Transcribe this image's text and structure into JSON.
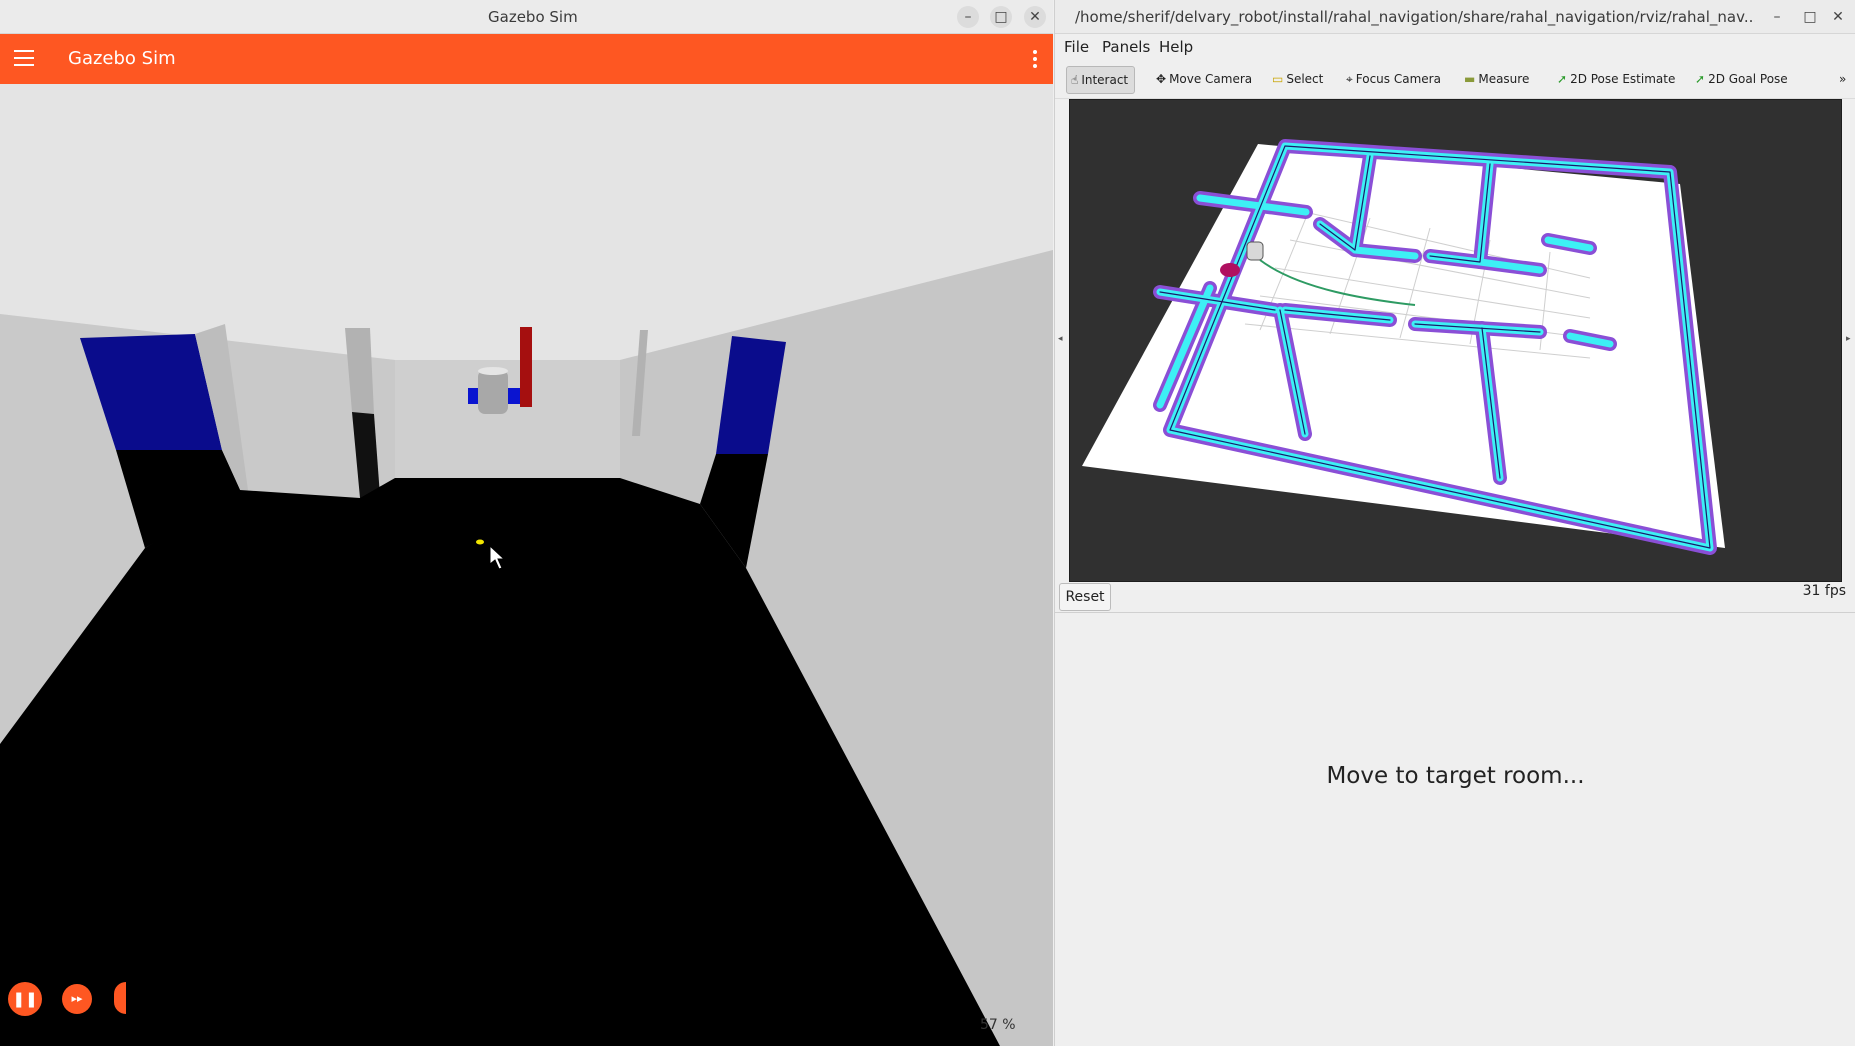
{
  "gazebo": {
    "window_title": "Gazebo Sim",
    "header_title": "Gazebo Sim",
    "rtf_text": "57 %",
    "controls": {
      "minimize": "–",
      "maximize": "□",
      "close": "✕"
    },
    "play": {
      "pause_icon": "❚❚",
      "step_icon": "▸▸"
    }
  },
  "rviz": {
    "window_title": "/home/sherif/delvary_robot/install/rahal_navigation/share/rahal_navigation/rviz/rahal_nav....",
    "controls": {
      "minimize": "–",
      "maximize": "□",
      "close": "✕"
    },
    "menu": [
      "File",
      "Panels",
      "Help"
    ],
    "tools": [
      {
        "label": "Interact",
        "icon": "hand-icon",
        "glyph": "☝"
      },
      {
        "label": "Move Camera",
        "icon": "move-icon",
        "glyph": "✥"
      },
      {
        "label": "Select",
        "icon": "select-icon",
        "glyph": "▭"
      },
      {
        "label": "Focus Camera",
        "icon": "focus-icon",
        "glyph": "⌖"
      },
      {
        "label": "Measure",
        "icon": "ruler-icon",
        "glyph": "▬"
      },
      {
        "label": "2D Pose Estimate",
        "icon": "pose-arrow-icon",
        "glyph": "➚"
      },
      {
        "label": "2D Goal Pose",
        "icon": "goal-arrow-icon",
        "glyph": "➚"
      }
    ],
    "overflow": "»",
    "reset_label": "Reset",
    "fps": "31 fps",
    "status_message": "Move to target room...",
    "colors": {
      "inflation_cyan": "#3df0f5",
      "inflation_purple": "#8a4fd6",
      "path": "#2e9b63"
    }
  },
  "colors": {
    "gazebo_accent": "#fe5722"
  }
}
